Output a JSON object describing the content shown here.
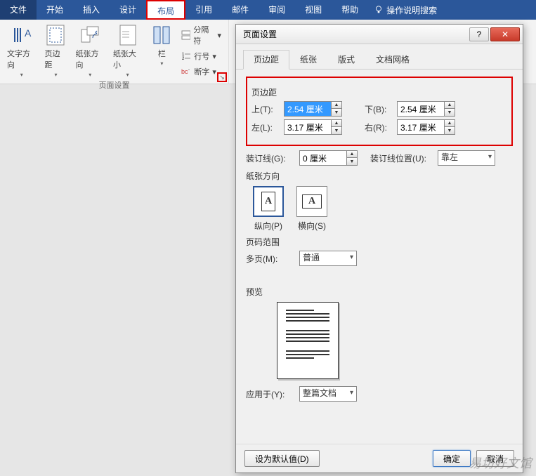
{
  "ribbon": {
    "tabs": {
      "file": "文件",
      "home": "开始",
      "insert": "插入",
      "design": "设计",
      "layout": "布局",
      "references": "引用",
      "mailings": "邮件",
      "review": "审阅",
      "view": "视图",
      "help": "帮助"
    },
    "search_prompt": "操作说明搜索",
    "group": {
      "text_direction": "文字方向",
      "margins": "页边距",
      "orientation": "纸张方向",
      "size": "纸张大小",
      "columns": "栏",
      "breaks": "分隔符",
      "line_numbers": "行号",
      "hyphenation": "断字",
      "label": "页面设置"
    }
  },
  "dialog": {
    "title": "页面设置",
    "tabs": {
      "margins": "页边距",
      "paper": "纸张",
      "layout": "版式",
      "grid": "文档网格"
    },
    "margins": {
      "section": "页边距",
      "top_label": "上(T):",
      "top_value": "2.54 厘米",
      "bottom_label": "下(B):",
      "bottom_value": "2.54 厘米",
      "left_label": "左(L):",
      "left_value": "3.17 厘米",
      "right_label": "右(R):",
      "right_value": "3.17 厘米",
      "gutter_label": "装订线(G):",
      "gutter_value": "0 厘米",
      "gutter_pos_label": "装订线位置(U):",
      "gutter_pos_value": "靠左"
    },
    "orientation": {
      "section": "纸张方向",
      "portrait": "纵向(P)",
      "landscape": "横向(S)"
    },
    "pages": {
      "section": "页码范围",
      "multi_label": "多页(M):",
      "multi_value": "普通"
    },
    "preview": {
      "section": "预览"
    },
    "apply": {
      "label": "应用于(Y):",
      "value": "整篇文档"
    },
    "footer": {
      "default": "设为默认值(D)",
      "ok": "确定",
      "cancel": "取消"
    }
  },
  "watermark": "易坊好文馆"
}
